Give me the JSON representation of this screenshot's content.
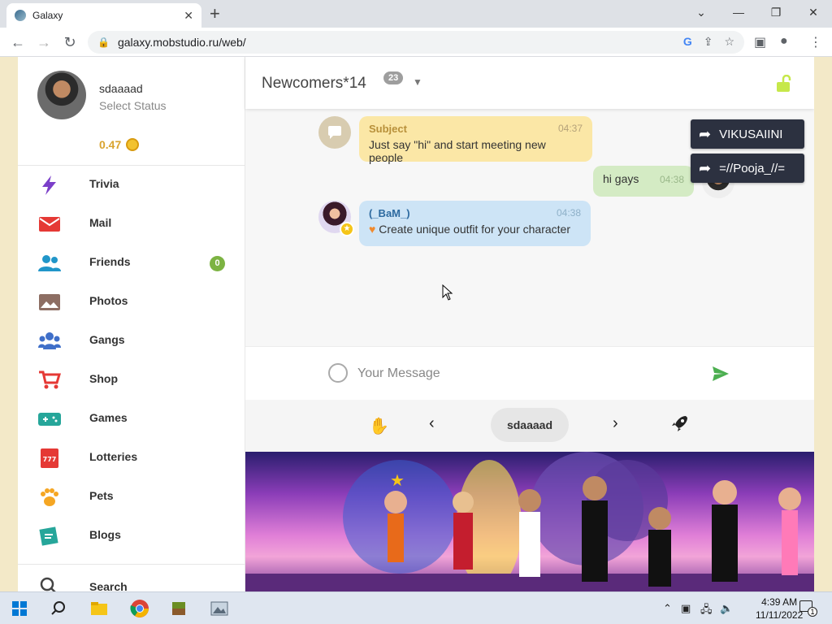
{
  "browser": {
    "tab_title": "Galaxy",
    "url": "galaxy.mobstudio.ru/web/"
  },
  "profile": {
    "username": "sdaaaad",
    "status": "Select Status",
    "coins": "0.47"
  },
  "menu": [
    {
      "label": "Trivia",
      "icon": "lightning-icon",
      "color": "#7b3fc9"
    },
    {
      "label": "Mail",
      "icon": "mail-icon",
      "color": "#e53935"
    },
    {
      "label": "Friends",
      "icon": "friends-icon",
      "color": "#2196c9",
      "badge": "0"
    },
    {
      "label": "Photos",
      "icon": "photo-icon",
      "color": "#8d6e63"
    },
    {
      "label": "Gangs",
      "icon": "gangs-icon",
      "color": "#3f6fc9"
    },
    {
      "label": "Shop",
      "icon": "cart-icon",
      "color": "#e53935"
    },
    {
      "label": "Games",
      "icon": "gamepad-icon",
      "color": "#26a69a"
    },
    {
      "label": "Lotteries",
      "icon": "ticket-icon",
      "color": "#e53935"
    },
    {
      "label": "Pets",
      "icon": "paw-icon",
      "color": "#f5a623"
    },
    {
      "label": "Blogs",
      "icon": "blog-icon",
      "color": "#26a69a"
    }
  ],
  "search_label": "Search",
  "chat": {
    "room": "Newcomers*14",
    "count": "23",
    "messages": [
      {
        "name": "Subject",
        "time": "04:37",
        "text": "Just say \"hi\" and start meeting new people"
      },
      {
        "name": "",
        "time": "04:38",
        "text": "hi gays"
      },
      {
        "name": "(_BaM_)",
        "time": "04:38",
        "text": "Create unique outfit for your character"
      }
    ],
    "notifications": [
      "VIKUSAIINI",
      "=//Pooja_//="
    ],
    "input_placeholder": "Your Message",
    "current_user": "sdaaaad"
  },
  "taskbar": {
    "time": "4:39 AM",
    "date": "11/11/2022",
    "notification_count": "1"
  }
}
